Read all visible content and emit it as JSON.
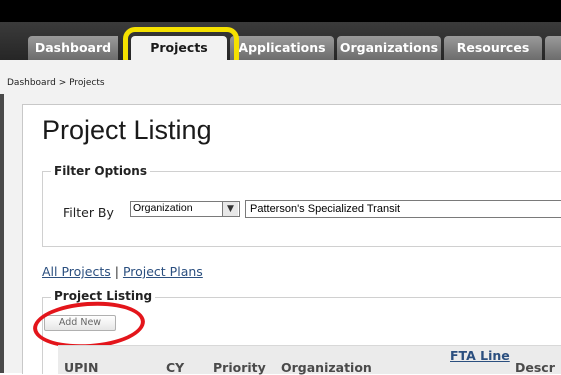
{
  "nav": {
    "tabs": [
      {
        "label": "Dashboard"
      },
      {
        "label": "Projects",
        "active": true
      },
      {
        "label": "Applications"
      },
      {
        "label": "Organizations"
      },
      {
        "label": "Resources"
      }
    ]
  },
  "breadcrumb": {
    "text": "Dashboard > Projects"
  },
  "page": {
    "title": "Project Listing"
  },
  "filter": {
    "legend": "Filter Options",
    "label": "Filter By",
    "select_value": "Organization",
    "input_value": "Patterson's Specialized Transit"
  },
  "links": {
    "all_projects": "All Projects",
    "separator": "|",
    "project_plans": "Project Plans"
  },
  "listing": {
    "legend": "Project Listing",
    "add_button": "Add New",
    "columns": [
      "UPIN",
      "CY",
      "Priority",
      "Organization",
      "FTA Line",
      "Descr"
    ]
  },
  "annotations": {
    "highlight_color": "#f5e100",
    "circle_color": "#e3151b"
  }
}
